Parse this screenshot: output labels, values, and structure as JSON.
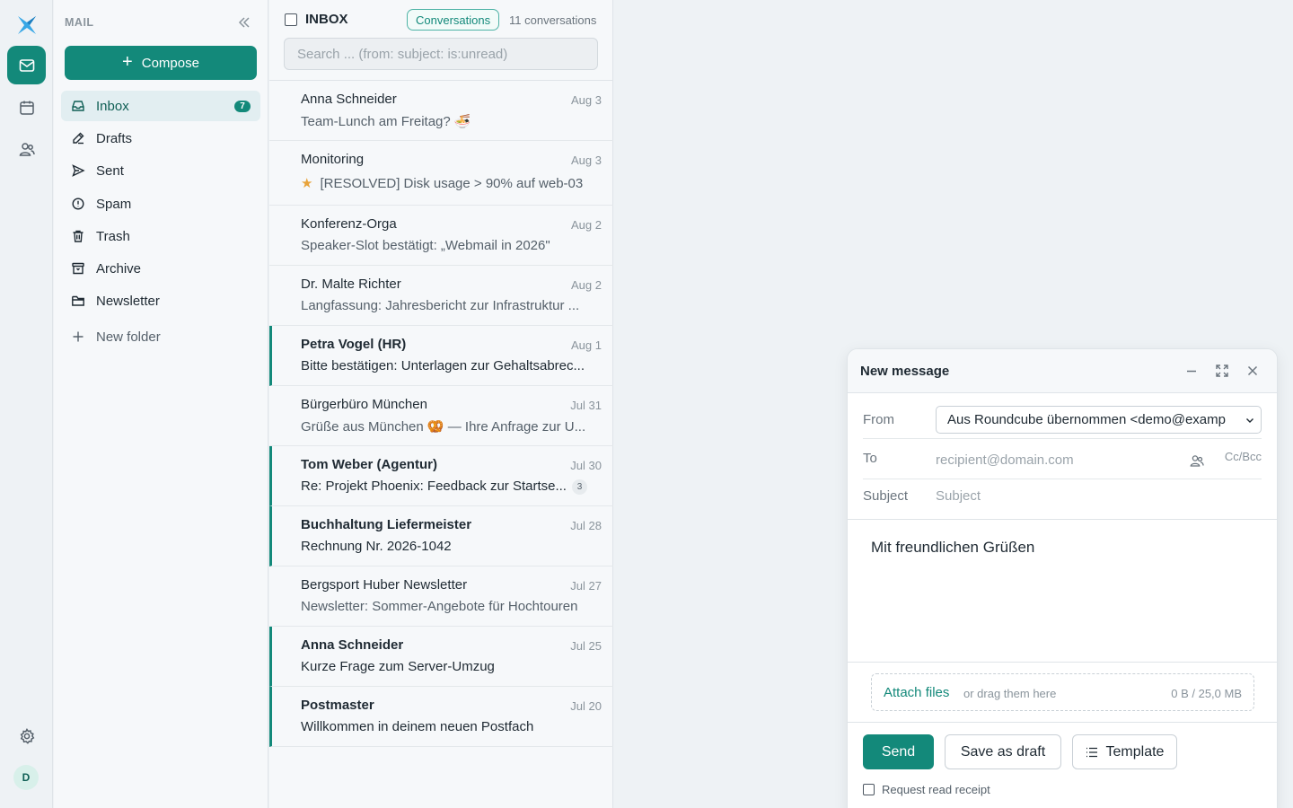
{
  "app": {
    "accent": "#13897a"
  },
  "rail": {
    "avatar_initial": "D",
    "items": [
      {
        "icon": "mail-icon",
        "active": true
      },
      {
        "icon": "calendar-icon",
        "active": false
      },
      {
        "icon": "contacts-icon",
        "active": false
      }
    ]
  },
  "folders": {
    "header": "MAIL",
    "compose_label": "Compose",
    "items": [
      {
        "label": "Inbox",
        "icon": "inbox-icon",
        "badge": "7",
        "active": true
      },
      {
        "label": "Drafts",
        "icon": "pencil-icon"
      },
      {
        "label": "Sent",
        "icon": "send-icon"
      },
      {
        "label": "Spam",
        "icon": "spam-icon"
      },
      {
        "label": "Trash",
        "icon": "trash-icon"
      },
      {
        "label": "Archive",
        "icon": "archive-icon"
      },
      {
        "label": "Newsletter",
        "icon": "folder-icon"
      }
    ],
    "new_folder_label": "New folder"
  },
  "list": {
    "title": "INBOX",
    "conversations_toggle": "Conversations",
    "count": "11 conversations",
    "search_placeholder": "Search ... (from: subject: is:unread)",
    "messages": [
      {
        "from": "Anna Schneider",
        "date": "Aug 3",
        "subject": "Team-Lunch am Freitag? 🍜",
        "unread": false
      },
      {
        "from": "Monitoring",
        "date": "Aug 3",
        "subject": "[RESOLVED] Disk usage > 90% auf web-03",
        "starred": true,
        "unread": false
      },
      {
        "from": "Konferenz-Orga",
        "date": "Aug 2",
        "subject": "Speaker-Slot bestätigt: „Webmail in 2026\"",
        "unread": false
      },
      {
        "from": "Dr. Malte Richter",
        "date": "Aug 2",
        "subject": "Langfassung: Jahresbericht zur Infrastruktur ...",
        "unread": false
      },
      {
        "from": "Petra Vogel (HR)",
        "date": "Aug 1",
        "subject": "Bitte bestätigen: Unterlagen zur Gehaltsabrec...",
        "unread": true
      },
      {
        "from": "Bürgerbüro München",
        "date": "Jul 31",
        "subject": "Grüße aus München 🥨 — Ihre Anfrage zur U...",
        "unread": false
      },
      {
        "from": "Tom Weber (Agentur)",
        "date": "Jul 30",
        "subject": "Re: Projekt Phoenix: Feedback zur Startse...",
        "thread_count": "3",
        "unread": true
      },
      {
        "from": "Buchhaltung Liefermeister",
        "date": "Jul 28",
        "subject": "Rechnung Nr. 2026-1042",
        "unread": true
      },
      {
        "from": "Bergsport Huber Newsletter",
        "date": "Jul 27",
        "subject": "Newsletter: Sommer-Angebote für Hochtouren",
        "unread": false
      },
      {
        "from": "Anna Schneider",
        "date": "Jul 25",
        "subject": "Kurze Frage zum Server-Umzug",
        "unread": true
      },
      {
        "from": "Postmaster",
        "date": "Jul 20",
        "subject": "Willkommen in deinem neuen Postfach",
        "unread": true
      }
    ]
  },
  "composer": {
    "title": "New message",
    "from_label": "From",
    "from_value": "Aus Roundcube übernommen <demo@examp",
    "to_label": "To",
    "to_placeholder": "recipient@domain.com",
    "ccbcc": "Cc/Bcc",
    "subject_label": "Subject",
    "subject_placeholder": "Subject",
    "body": "Mit freundlichen Grüßen",
    "attach_label": "Attach files",
    "attach_hint": "or drag them here",
    "attach_size": "0 B / 25,0 MB",
    "send_label": "Send",
    "draft_label": "Save as draft",
    "template_label": "Template",
    "receipt_label": "Request read receipt"
  }
}
